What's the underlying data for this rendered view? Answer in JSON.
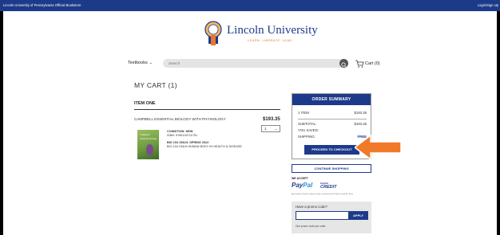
{
  "topbar": {
    "store_name": "Lincoln University of Pennsylvania Official Bookstore",
    "login_label": "Login/Sign Up"
  },
  "header": {
    "logo_name": "Lincoln University",
    "logo_tagline": "LEARN. LIBERATE. LEAD"
  },
  "nav": {
    "textbooks_label": "Textbooks",
    "search_placeholder": "Search",
    "cart_label": "Cart (0)"
  },
  "cart": {
    "title": "MY CART (1)",
    "item_heading": "ITEM ONE",
    "item": {
      "name": "CAMPBELL ESSENTIAL BIOLOGY WITH PHYSIOLOGY",
      "price": "$193.35",
      "quantity": "1",
      "condition": "CONDITION: NEW",
      "isbn": "ISBN: 9780134711751",
      "course_line_1": "BIO 104 ONLN: SPRING 2022",
      "course_line_2": "BIO 104 ONLN HUMAN BODY IN HEALTH & DISEASE",
      "cover_line_1": "Campbell",
      "cover_line_2": "essential biology"
    }
  },
  "summary": {
    "title": "ORDER SUMMARY",
    "items_label": "1 ITEM",
    "items_value": "$193.35",
    "subtotal_label": "SUBTOTAL:",
    "subtotal_value": "$193.35",
    "saved_label": "YOU SAVED:",
    "shipping_label": "SHIPPING:",
    "shipping_value": "FREE",
    "checkout_label": "PROCEED TO CHECKOUT",
    "continue_label": "CONTINUE SHOPPING"
  },
  "payment": {
    "we_accept": "WE ACCEPT",
    "paypal_a": "Pay",
    "paypal_b": "Pal",
    "paypal_credit_a": "PayPal",
    "paypal_credit_b": "CREDIT",
    "note": "Any member PayPal or BuyCard only; see Accessed & PayPal credit/ Mr. Terms"
  },
  "promo": {
    "label": "Have a promo code?",
    "apply_label": "APPLY",
    "note": "One promo code per order"
  },
  "colors": {
    "brand": "#1d3a8a",
    "pointer": "#f07a2a",
    "accent": "#e8772e"
  }
}
